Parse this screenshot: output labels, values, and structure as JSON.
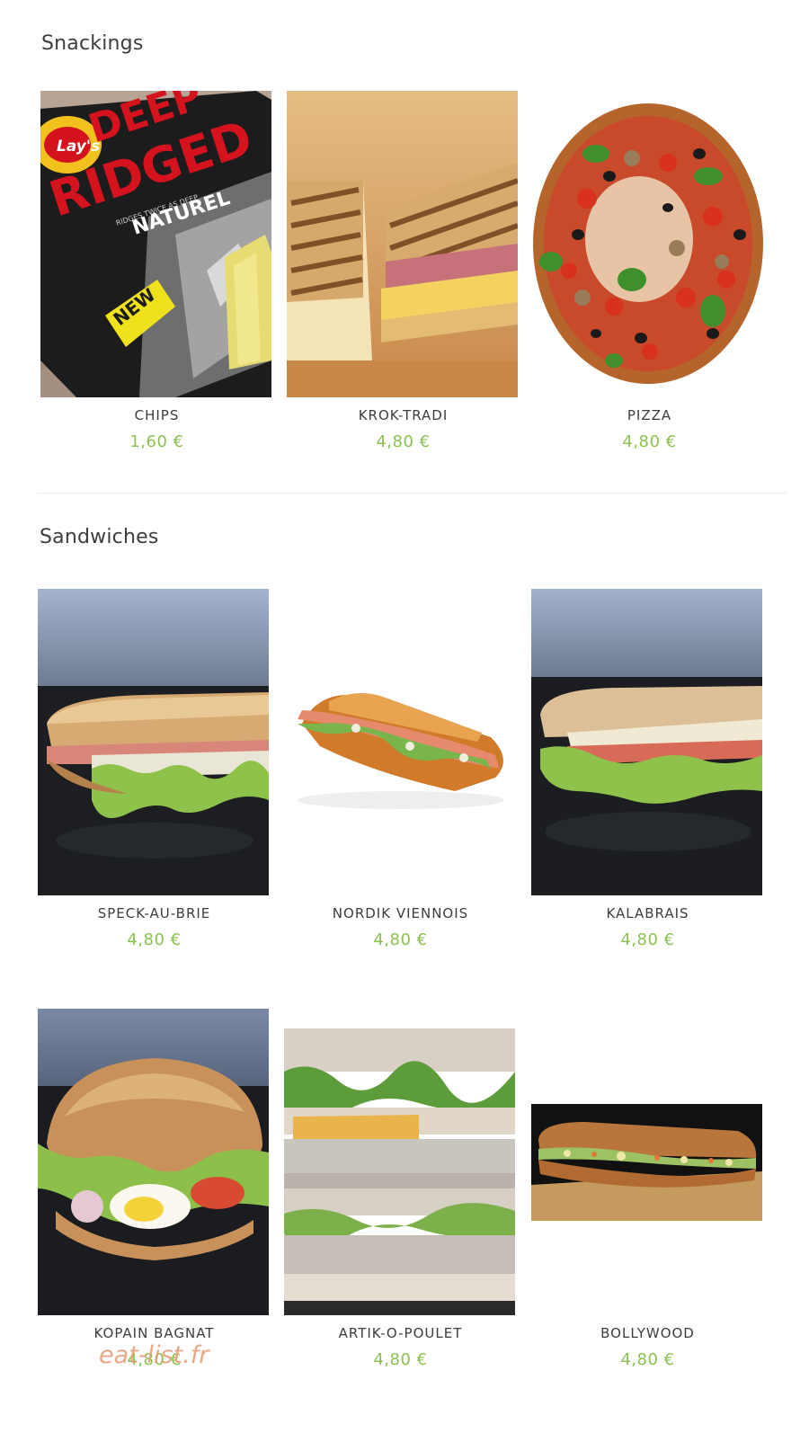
{
  "sections": [
    {
      "title": "Snackings",
      "products": [
        {
          "name": "CHIPS",
          "price": "1,60 €",
          "image": "chips-bag-photo"
        },
        {
          "name": "KROK-TRADI",
          "price": "4,80 €",
          "image": "croque-sandwich-photo"
        },
        {
          "name": "PIZZA",
          "price": "4,80 €",
          "image": "pizza-photo"
        }
      ]
    },
    {
      "title": "Sandwiches",
      "products": [
        {
          "name": "SPECK-AU-BRIE",
          "price": "4,80 €",
          "image": "baguette-sandwich-photo"
        },
        {
          "name": "NORDIK VIENNOIS",
          "price": "4,80 €",
          "image": "viennese-sandwich-photo"
        },
        {
          "name": "KALABRAIS",
          "price": "4,80 €",
          "image": "baguette-sandwich-photo"
        },
        {
          "name": "KOPAIN BAGNAT",
          "price": "4,80 €",
          "image": "round-bun-sandwich-photo"
        },
        {
          "name": "ARTIK-O-POULET",
          "price": "4,80 €",
          "image": "club-sandwich-photo"
        },
        {
          "name": "BOLLYWOOD",
          "price": "4,80 €",
          "image": "long-sandwich-photo"
        }
      ]
    }
  ],
  "packaging_text": {
    "brand": "Lay's",
    "line1": "DEEP",
    "line2": "RIDGED",
    "line3": "NATUREL",
    "tag": "NEW",
    "small": "RIDGES TWICE AS DEEP"
  },
  "watermark": "eat-list.fr",
  "colors": {
    "price": "#8cc152",
    "heading": "#3d3d3d",
    "watermark": "#e8a07a"
  }
}
